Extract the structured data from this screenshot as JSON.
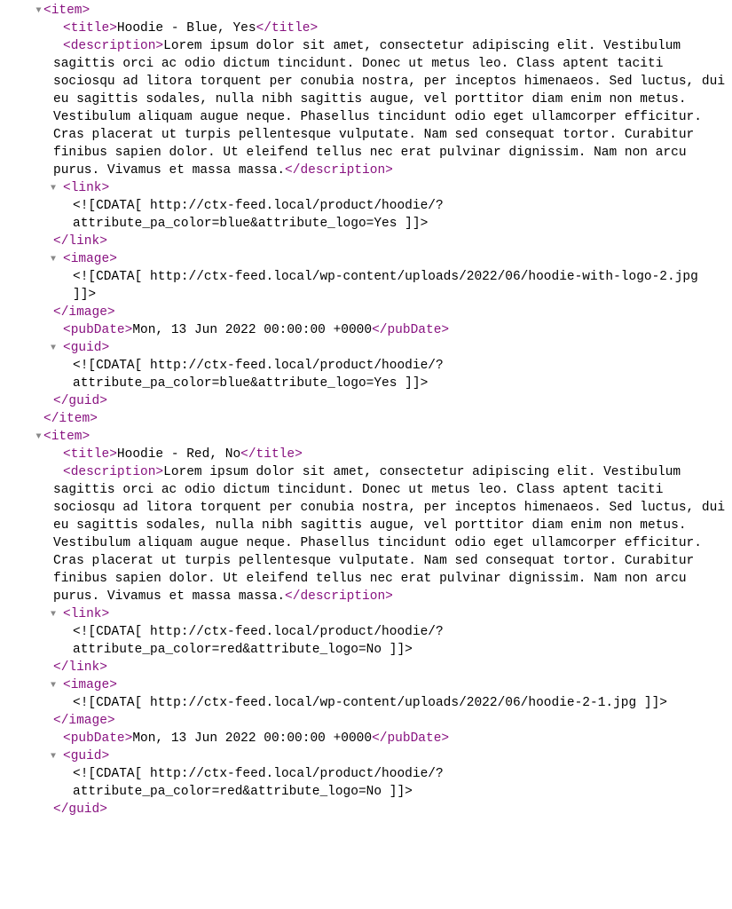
{
  "items": [
    {
      "tags": {
        "item_open": "<item>",
        "item_close": "</item>",
        "title_open": "<title>",
        "title_close": "</title>",
        "desc_open": "<description>",
        "desc_close": "</description>",
        "link_open": "<link>",
        "link_close": "</link>",
        "image_open": "<image>",
        "image_close": "</image>",
        "pub_open": "<pubDate>",
        "pub_close": "</pubDate>",
        "guid_open": "<guid>",
        "guid_close": "</guid>"
      },
      "title": "Hoodie - Blue, Yes",
      "description": "Lorem ipsum dolor sit amet, consectetur adipiscing elit. Vestibulum sagittis orci ac odio dictum tincidunt. Donec ut metus leo. Class aptent taciti sociosqu ad litora torquent per conubia nostra, per inceptos himenaeos. Sed luctus, dui eu sagittis sodales, nulla nibh sagittis augue, vel porttitor diam enim non metus. Vestibulum aliquam augue neque. Phasellus tincidunt odio eget ullamcorper efficitur. Cras placerat ut turpis pellentesque vulputate. Nam sed consequat tortor. Curabitur finibus sapien dolor. Ut eleifend tellus nec erat pulvinar dignissim. Nam non arcu purus. Vivamus et massa massa.",
      "link_cdata": "<![CDATA[ http://ctx-feed.local/product/hoodie/?attribute_pa_color=blue&attribute_logo=Yes ]]>",
      "image_cdata": "<![CDATA[ http://ctx-feed.local/wp-content/uploads/2022/06/hoodie-with-logo-2.jpg ]]>",
      "pubDate": "Mon, 13 Jun 2022 00:00:00 +0000",
      "guid_cdata": "<![CDATA[ http://ctx-feed.local/product/hoodie/?attribute_pa_color=blue&attribute_logo=Yes ]]>"
    },
    {
      "tags": {
        "item_open": "<item>",
        "title_open": "<title>",
        "title_close": "</title>",
        "desc_open": "<description>",
        "desc_close": "</description>",
        "link_open": "<link>",
        "link_close": "</link>",
        "image_open": "<image>",
        "image_close": "</image>",
        "pub_open": "<pubDate>",
        "pub_close": "</pubDate>",
        "guid_open": "<guid>",
        "guid_close": "</guid>"
      },
      "title": "Hoodie - Red, No",
      "description": "Lorem ipsum dolor sit amet, consectetur adipiscing elit. Vestibulum sagittis orci ac odio dictum tincidunt. Donec ut metus leo. Class aptent taciti sociosqu ad litora torquent per conubia nostra, per inceptos himenaeos. Sed luctus, dui eu sagittis sodales, nulla nibh sagittis augue, vel porttitor diam enim non metus. Vestibulum aliquam augue neque. Phasellus tincidunt odio eget ullamcorper efficitur. Cras placerat ut turpis pellentesque vulputate. Nam sed consequat tortor. Curabitur finibus sapien dolor. Ut eleifend tellus nec erat pulvinar dignissim. Nam non arcu purus. Vivamus et massa massa.",
      "link_cdata": "<![CDATA[ http://ctx-feed.local/product/hoodie/?attribute_pa_color=red&attribute_logo=No ]]>",
      "image_cdata": "<![CDATA[ http://ctx-feed.local/wp-content/uploads/2022/06/hoodie-2-1.jpg ]]>",
      "pubDate": "Mon, 13 Jun 2022 00:00:00 +0000",
      "guid_cdata": "<![CDATA[ http://ctx-feed.local/product/hoodie/?attribute_pa_color=red&attribute_logo=No ]]>"
    }
  ]
}
